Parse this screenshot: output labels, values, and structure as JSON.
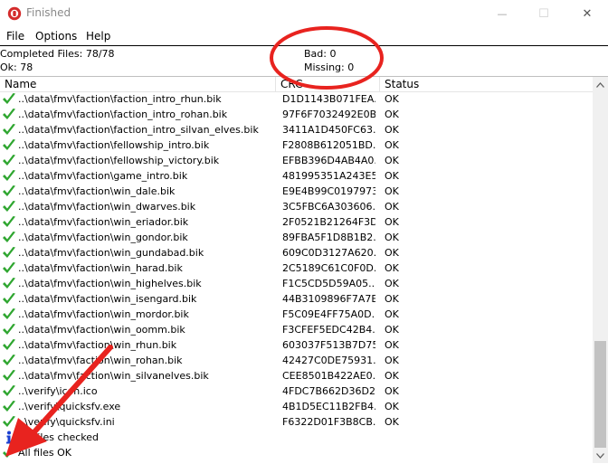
{
  "window": {
    "title": "Finished",
    "minimize": "—",
    "maximize": "☐",
    "close": "✕"
  },
  "menu": {
    "items": [
      "File",
      "Options",
      "Help"
    ]
  },
  "summary": {
    "completed": "Completed Files: 78/78",
    "ok": "Ok: 78",
    "bad": "Bad: 0",
    "missing": "Missing: 0"
  },
  "columns": {
    "name": "Name",
    "crc": "CRC",
    "status": "Status"
  },
  "rows": [
    {
      "name": "..\\data\\fmv\\faction\\faction_intro_rhun.bik",
      "crc": "D1D1143B071FEA...",
      "status": "OK"
    },
    {
      "name": "..\\data\\fmv\\faction\\faction_intro_rohan.bik",
      "crc": "97F6F7032492E0B...",
      "status": "OK"
    },
    {
      "name": "..\\data\\fmv\\faction\\faction_intro_silvan_elves.bik",
      "crc": "3411A1D450FC63...",
      "status": "OK"
    },
    {
      "name": "..\\data\\fmv\\faction\\fellowship_intro.bik",
      "crc": "F2808B612051BD...",
      "status": "OK"
    },
    {
      "name": "..\\data\\fmv\\faction\\fellowship_victory.bik",
      "crc": "EFBB396D4AB4A0...",
      "status": "OK"
    },
    {
      "name": "..\\data\\fmv\\faction\\game_intro.bik",
      "crc": "481995351A243E5...",
      "status": "OK"
    },
    {
      "name": "..\\data\\fmv\\faction\\win_dale.bik",
      "crc": "E9E4B99C0197973...",
      "status": "OK"
    },
    {
      "name": "..\\data\\fmv\\faction\\win_dwarves.bik",
      "crc": "3C5FBC6A303606...",
      "status": "OK"
    },
    {
      "name": "..\\data\\fmv\\faction\\win_eriador.bik",
      "crc": "2F0521B21264F3D...",
      "status": "OK"
    },
    {
      "name": "..\\data\\fmv\\faction\\win_gondor.bik",
      "crc": "89FBA5F1D8B1B2...",
      "status": "OK"
    },
    {
      "name": "..\\data\\fmv\\faction\\win_gundabad.bik",
      "crc": "609C0D3127A620...",
      "status": "OK"
    },
    {
      "name": "..\\data\\fmv\\faction\\win_harad.bik",
      "crc": "2C5189C61C0F0D...",
      "status": "OK"
    },
    {
      "name": "..\\data\\fmv\\faction\\win_highelves.bik",
      "crc": "F1C5CD5D59A05...",
      "status": "OK"
    },
    {
      "name": "..\\data\\fmv\\faction\\win_isengard.bik",
      "crc": "44B3109896F7A7E...",
      "status": "OK"
    },
    {
      "name": "..\\data\\fmv\\faction\\win_mordor.bik",
      "crc": "F5C09E4FF75A0D...",
      "status": "OK"
    },
    {
      "name": "..\\data\\fmv\\faction\\win_oomm.bik",
      "crc": "F3CFEF5EDC42B4...",
      "status": "OK"
    },
    {
      "name": "..\\data\\fmv\\faction\\win_rhun.bik",
      "crc": "603037F513B7D75...",
      "status": "OK"
    },
    {
      "name": "..\\data\\fmv\\faction\\win_rohan.bik",
      "crc": "42427C0DE75931...",
      "status": "OK"
    },
    {
      "name": "..\\data\\fmv\\faction\\win_silvanelves.bik",
      "crc": "CEE8501B422AE0...",
      "status": "OK"
    },
    {
      "name": "..\\verify\\icon.ico",
      "crc": "4FDC7B662D36D2...",
      "status": "OK"
    },
    {
      "name": "..\\verify\\quicksfv.exe",
      "crc": "4B1D5EC11B2FB4...",
      "status": "OK"
    },
    {
      "name": "..\\verify\\quicksfv.ini",
      "crc": "F6322D01F3B8CB...",
      "status": "OK"
    }
  ],
  "footer": [
    {
      "icon": "info-icon",
      "text": "78 files checked"
    },
    {
      "icon": "check-icon",
      "text": "All files OK"
    }
  ],
  "colors": {
    "check": "#2fa630",
    "info": "#1a3fd1",
    "annotation": "#e8231f"
  }
}
